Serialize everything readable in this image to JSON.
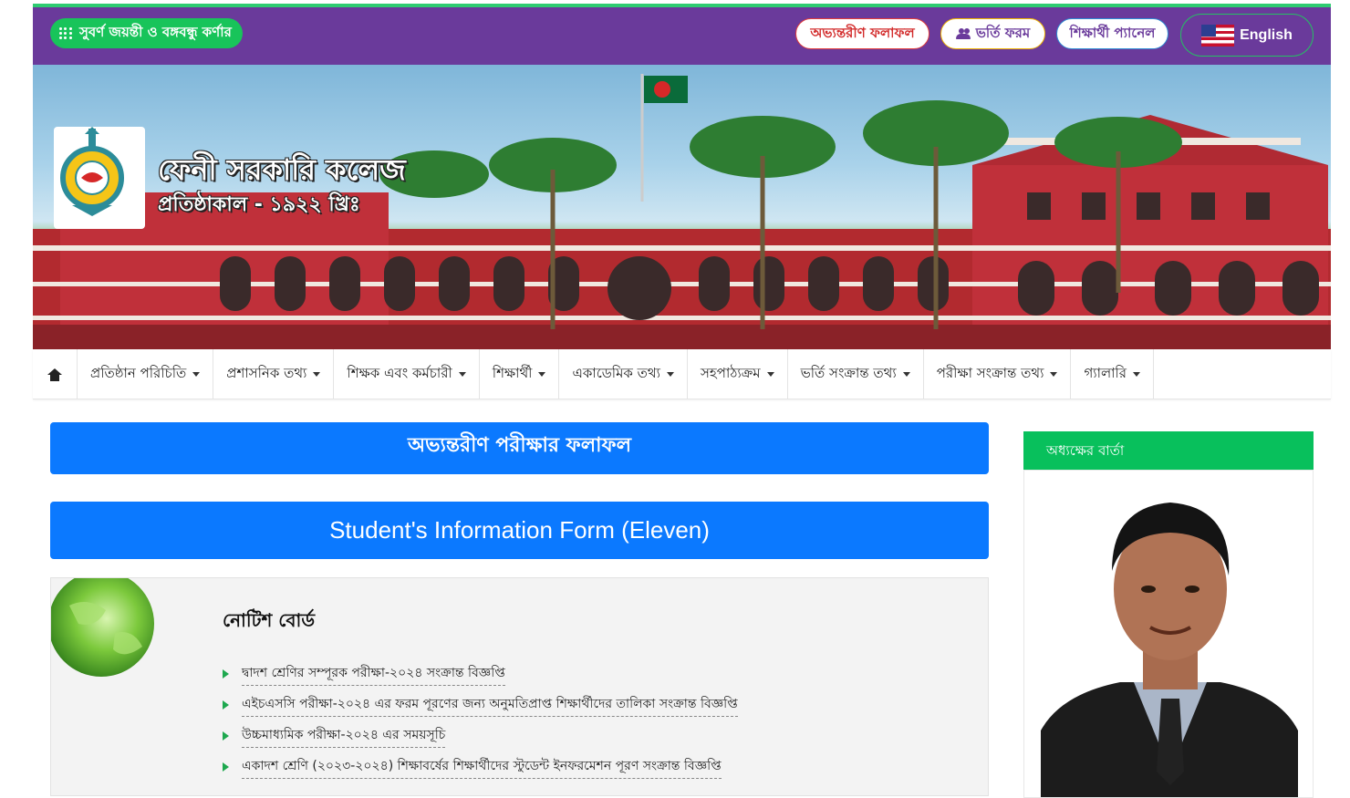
{
  "topbar": {
    "golden_jubilee": "সুবর্ণ জয়ন্তী ও বঙ্গবন্ধু কর্ণার",
    "results": "অভ্যন্তরীণ ফলাফল",
    "admission_form": "ভর্তি ফরম",
    "student_panel": "শিক্ষার্থী প্যানেল",
    "language": "English"
  },
  "header": {
    "college_name": "ফেনী সরকারি কলেজ",
    "established": "প্রতিষ্ঠাকাল - ১৯২২ খ্রিঃ"
  },
  "nav": {
    "items": [
      "প্রতিষ্ঠান পরিচিতি",
      "প্রশাসনিক তথ্য",
      "শিক্ষক এবং কর্মচারী",
      "শিক্ষার্থী",
      "একাডেমিক তথ্য",
      "সহপাঠ্যক্রম",
      "ভর্তি সংক্রান্ত তথ্য",
      "পরীক্ষা সংক্রান্ত তথ্য",
      "গ্যালারি"
    ]
  },
  "main": {
    "internal_results_button": "অভ্যন্তরীণ পরীক্ষার ফলাফল",
    "student_info_button": "Student's Information Form (Eleven)"
  },
  "notice_board": {
    "title": "নোটিশ বোর্ড",
    "items": [
      "দ্বাদশ শ্রেণির সম্পূরক পরীক্ষা-২০২৪ সংক্রান্ত বিজ্ঞপ্তি",
      "এইচএসসি পরীক্ষা-২০২৪ এর ফরম পূরণের জন্য অনুমতিপ্রাপ্ত শিক্ষার্থীদের তালিকা সংক্রান্ত বিজ্ঞপ্তি",
      "উচ্চমাধ্যমিক পরীক্ষা-২০২৪ এর সময়সূচি",
      "একাদশ শ্রেণি (২০২৩-২০২৪) শিক্ষাবর্ষের শিক্ষার্থীদের স্টুডেন্ট ইনফরমেশন পূরণ সংক্রান্ত বিজ্ঞপ্তি"
    ]
  },
  "sidebar": {
    "principal_message_title": "অধ্যক্ষের বার্তা"
  },
  "colors": {
    "topbar": "#6a3a9b",
    "accent_green": "#08c05c",
    "button_blue": "#0b79ff"
  }
}
